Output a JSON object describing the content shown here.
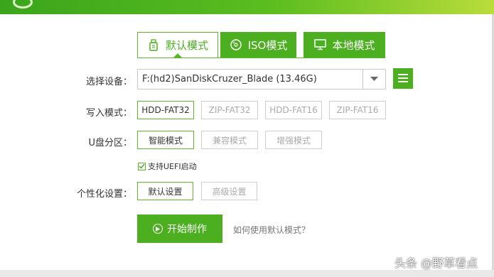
{
  "tabs": [
    {
      "label": "默认模式",
      "icon": "usb-drive-icon"
    },
    {
      "label": "ISO模式",
      "icon": "disc-icon"
    },
    {
      "label": "本地模式",
      "icon": "monitor-icon"
    }
  ],
  "device": {
    "label": "选择设备：",
    "value": "F:(hd2)SanDiskCruzer_Blade (13.46G)"
  },
  "write_mode": {
    "label": "写入模式：",
    "options": [
      "HDD-FAT32",
      "ZIP-FAT32",
      "HDD-FAT16",
      "ZIP-FAT16"
    ],
    "selected": "HDD-FAT32"
  },
  "partition": {
    "label": "U盘分区：",
    "options": [
      "智能模式",
      "兼容模式",
      "增强模式"
    ],
    "selected": "智能模式"
  },
  "uefi": {
    "label": "支持UEFI启动",
    "checked": true
  },
  "personalize": {
    "label": "个性化设置：",
    "options": [
      "默认设置",
      "高级设置"
    ],
    "selected": "默认设置"
  },
  "start_label": "开始制作",
  "help_text": "如何使用默认模式？",
  "watermark": "头条 @野草看点",
  "colors": {
    "accent": "#4caf20",
    "border": "#cfcfcf"
  }
}
